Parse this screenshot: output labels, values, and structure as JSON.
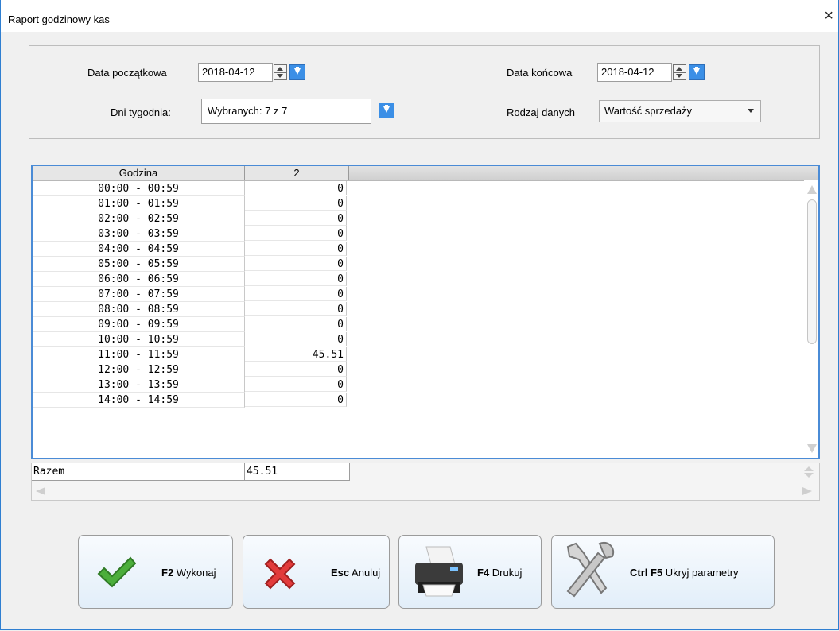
{
  "window": {
    "title": "Raport godzinowy kas",
    "close_label": "×"
  },
  "params": {
    "start_label": "Data początkowa",
    "start_value": "2018-04-12",
    "end_label": "Data końcowa",
    "end_value": "2018-04-12",
    "days_label": "Dni tygodnia:",
    "days_value": "Wybranych: 7 z 7",
    "datatype_label": "Rodzaj danych",
    "datatype_value": "Wartość sprzedaży"
  },
  "grid": {
    "columns": [
      "Godzina",
      "2"
    ],
    "rows": [
      {
        "hour": "00:00 - 00:59",
        "value": "0"
      },
      {
        "hour": "01:00 - 01:59",
        "value": "0"
      },
      {
        "hour": "02:00 - 02:59",
        "value": "0"
      },
      {
        "hour": "03:00 - 03:59",
        "value": "0"
      },
      {
        "hour": "04:00 - 04:59",
        "value": "0"
      },
      {
        "hour": "05:00 - 05:59",
        "value": "0"
      },
      {
        "hour": "06:00 - 06:59",
        "value": "0"
      },
      {
        "hour": "07:00 - 07:59",
        "value": "0"
      },
      {
        "hour": "08:00 - 08:59",
        "value": "0"
      },
      {
        "hour": "09:00 - 09:59",
        "value": "0"
      },
      {
        "hour": "10:00 - 10:59",
        "value": "0"
      },
      {
        "hour": "11:00 - 11:59",
        "value": "45.51"
      },
      {
        "hour": "12:00 - 12:59",
        "value": "0"
      },
      {
        "hour": "13:00 - 13:59",
        "value": "0"
      },
      {
        "hour": "14:00 - 14:59",
        "value": "0"
      }
    ],
    "total_label": "Razem",
    "total_value": "45.51"
  },
  "buttons": {
    "run": {
      "key": "F2",
      "label": "Wykonaj"
    },
    "cancel": {
      "key": "Esc",
      "label": "Anuluj"
    },
    "print": {
      "key": "F4",
      "label": "Drukuj"
    },
    "hide": {
      "key": "Ctrl F5",
      "label": "Ukryj parametry"
    }
  }
}
